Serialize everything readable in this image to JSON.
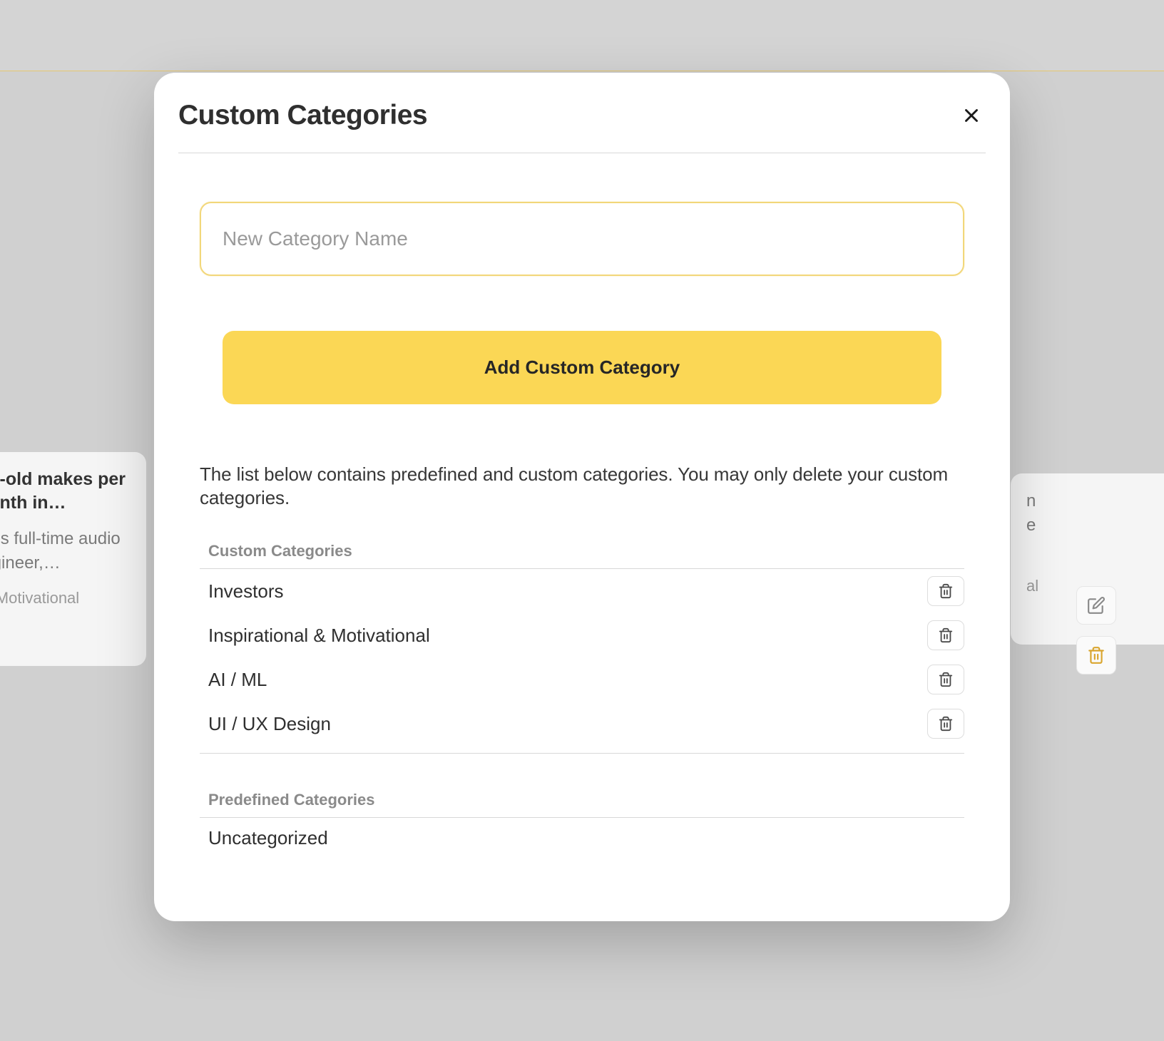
{
  "modal": {
    "title": "Custom Categories",
    "input_placeholder": "New Category Name",
    "add_button_label": "Add Custom Category",
    "info_text": "The list below contains predefined and custom categories. You may only delete your custom categories.",
    "custom_section_title": "Custom Categories",
    "predefined_section_title": "Predefined Categories",
    "custom_categories": [
      {
        "name": "Investors"
      },
      {
        "name": "Inspirational & Motivational"
      },
      {
        "name": "AI / ML"
      },
      {
        "name": "UI / UX Design"
      }
    ],
    "predefined_categories": [
      {
        "name": "Uncategorized"
      }
    ]
  },
  "background": {
    "card_left_title": "ear-old makes per month in…",
    "card_left_desc": "g his full-time audio engineer,…",
    "card_left_tag": "l & Motivational",
    "card_right_text1": "n",
    "card_right_text2": "e",
    "card_right_tag": "al"
  }
}
